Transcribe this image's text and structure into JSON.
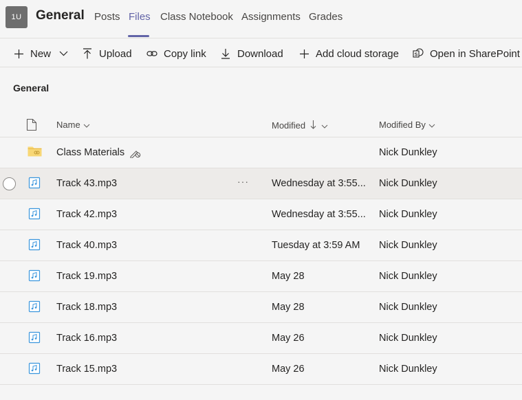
{
  "header": {
    "avatar": "1U",
    "title": "General",
    "tabs": [
      {
        "label": "Posts",
        "active": false
      },
      {
        "label": "Files",
        "active": true
      },
      {
        "label": "Class Notebook",
        "active": false
      },
      {
        "label": "Assignments",
        "active": false
      },
      {
        "label": "Grades",
        "active": false
      }
    ]
  },
  "toolbar": {
    "new_label": "New",
    "upload_label": "Upload",
    "copy_link_label": "Copy link",
    "download_label": "Download",
    "add_cloud_label": "Add cloud storage",
    "sharepoint_label": "Open in SharePoint"
  },
  "section_title": "General",
  "columns": {
    "name": "Name",
    "modified": "Modified",
    "modified_by": "Modified By"
  },
  "rows": [
    {
      "type": "folder",
      "name": "Class Materials",
      "modified": "",
      "modified_by": "Nick Dunkley"
    },
    {
      "type": "audio",
      "name": "Track 43.mp3",
      "modified": "Wednesday at 3:55...",
      "modified_by": "Nick Dunkley"
    },
    {
      "type": "audio",
      "name": "Track 42.mp3",
      "modified": "Wednesday at 3:55...",
      "modified_by": "Nick Dunkley"
    },
    {
      "type": "audio",
      "name": "Track 40.mp3",
      "modified": "Tuesday at 3:59 AM",
      "modified_by": "Nick Dunkley"
    },
    {
      "type": "audio",
      "name": "Track 19.mp3",
      "modified": "May 28",
      "modified_by": "Nick Dunkley"
    },
    {
      "type": "audio",
      "name": "Track 18.mp3",
      "modified": "May 28",
      "modified_by": "Nick Dunkley"
    },
    {
      "type": "audio",
      "name": "Track 16.mp3",
      "modified": "May 26",
      "modified_by": "Nick Dunkley"
    },
    {
      "type": "audio",
      "name": "Track 15.mp3",
      "modified": "May 26",
      "modified_by": "Nick Dunkley"
    }
  ],
  "colors": {
    "accent": "#6264a7",
    "folder": "#f8d775",
    "audio_icon": "#3a96dd"
  }
}
